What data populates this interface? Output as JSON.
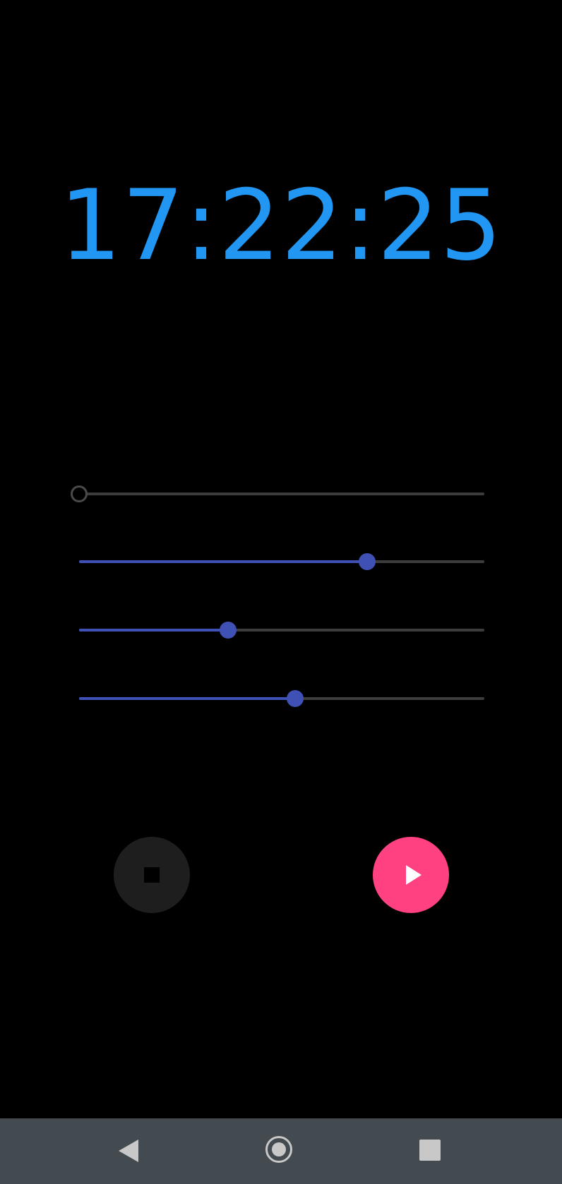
{
  "clock": {
    "time": "17:22:25",
    "color": "#2196f3"
  },
  "sliders": [
    {
      "name": "slider-1",
      "value": 0.0
    },
    {
      "name": "slider-2",
      "value": 0.71
    },
    {
      "name": "slider-3",
      "value": 0.367
    },
    {
      "name": "slider-4",
      "value": 0.533
    }
  ],
  "controls": {
    "stop": {
      "icon": "stop-icon",
      "background": "#1e1e1e"
    },
    "play": {
      "icon": "play-icon",
      "background": "#ff4081"
    }
  },
  "colors": {
    "accent": "#3f51b5",
    "track": "#3d3d3d",
    "navbar": "#434b50"
  },
  "navbar": {
    "back_icon": "back-icon",
    "home_icon": "home-icon",
    "recents_icon": "recents-icon"
  }
}
